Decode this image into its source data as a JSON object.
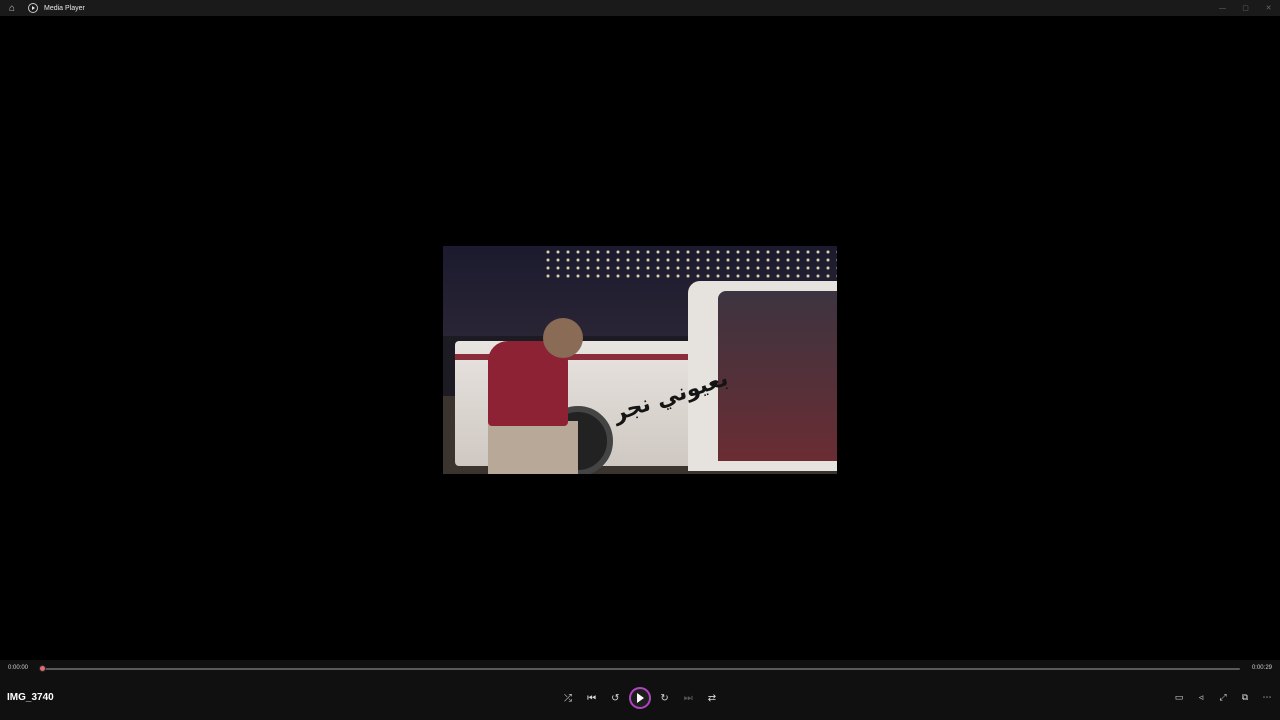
{
  "window": {
    "title": "Media Player",
    "minimize": "—",
    "maximize": "▢",
    "close": "✕",
    "home": "⌂"
  },
  "video": {
    "overlay_text": "بعيوني نجر"
  },
  "playback": {
    "current_time": "0:00:00",
    "total_time": "0:00:29",
    "progress": 0.0,
    "media_title": "IMG_3740"
  },
  "controls": {
    "shuffle": "⤮",
    "previous": "⏮",
    "back10": "↺",
    "forward30": "↻",
    "next": "⏭",
    "repeat": "⇄",
    "subtitles": "▭",
    "volume": "◃",
    "fullscreen": "⤢",
    "miniplayer": "⧉",
    "more": "⋯"
  },
  "colors": {
    "accent": "#b045c0",
    "seek_thumb": "#e46a74"
  }
}
